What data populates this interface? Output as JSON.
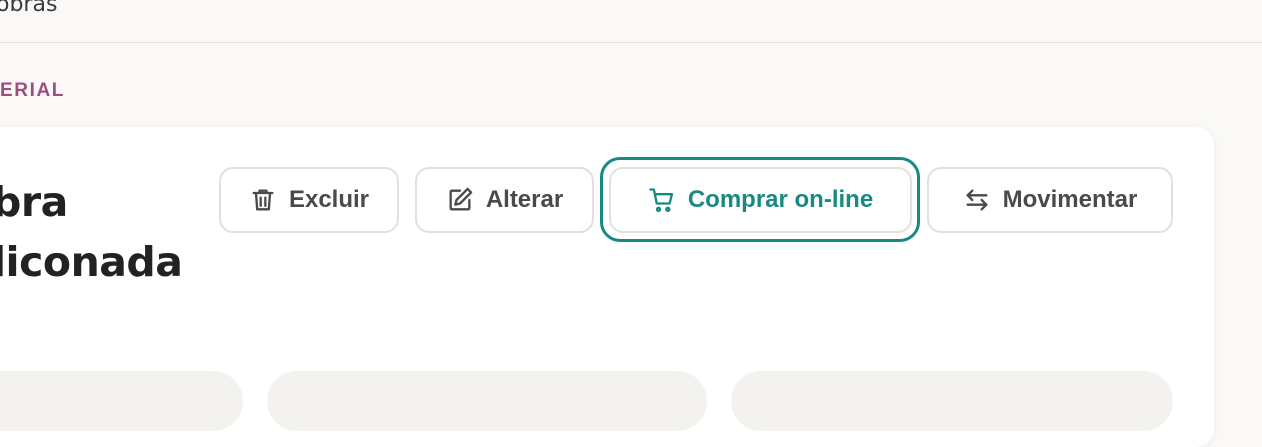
{
  "topbar": {
    "crumb": "obras"
  },
  "section": {
    "label": "ERIAL"
  },
  "item": {
    "title_line1": "bra",
    "title_line2": "liconada"
  },
  "actions": [
    {
      "label": "Excluir",
      "icon": "trash-icon"
    },
    {
      "label": "Alterar",
      "icon": "edit-icon"
    },
    {
      "label": "Comprar on-line",
      "icon": "cart-icon",
      "focused": true
    },
    {
      "label": "Movimentar",
      "icon": "swap-arrows-icon"
    }
  ],
  "colors": {
    "accent": "#198a82",
    "section_label": "#9b4f7e",
    "button_text": "#4a4a4a",
    "background": "#faf9f7"
  }
}
